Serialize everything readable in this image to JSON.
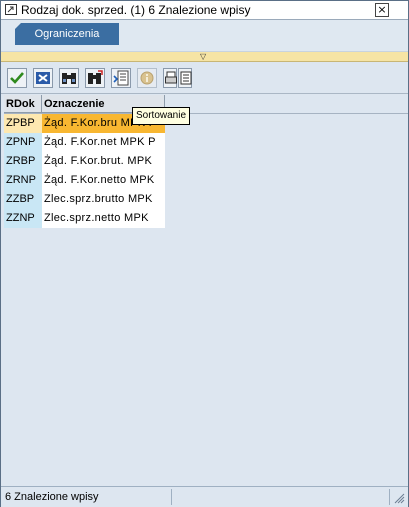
{
  "window": {
    "title": "Rodzaj dok. sprzed. (1)   6 Znalezione wpisy",
    "close_glyph": "×"
  },
  "tabs": [
    {
      "label": "Ograniczenia"
    }
  ],
  "collapse_glyph": "▽",
  "toolbar": {
    "buttons": [
      {
        "icon": "checkmark-icon"
      },
      {
        "icon": "cancel-x-icon"
      },
      {
        "icon": "binoculars-icon"
      },
      {
        "icon": "find-next-icon"
      },
      {
        "icon": "sort-icon"
      },
      {
        "icon": "info-icon"
      },
      {
        "icon": "print-icon"
      },
      {
        "icon": "list-icon"
      }
    ],
    "tooltip": "Sortowanie"
  },
  "grid": {
    "columns": [
      "RDok",
      "Oznaczenie"
    ],
    "rows": [
      {
        "code": "ZPBP",
        "desc": "Żąd. F.Kor.bru MPK P",
        "selected": true
      },
      {
        "code": "ZPNP",
        "desc": "Żąd. F.Kor.net MPK P",
        "selected": false
      },
      {
        "code": "ZRBP",
        "desc": "Żąd. F.Kor.brut. MPK",
        "selected": false
      },
      {
        "code": "ZRNP",
        "desc": "Żąd. F.Kor.netto MPK",
        "selected": false
      },
      {
        "code": "ZZBP",
        "desc": "Zlec.sprz.brutto MPK",
        "selected": false
      },
      {
        "code": "ZZNP",
        "desc": "Zlec.sprz.netto MPK",
        "selected": false
      }
    ]
  },
  "status": {
    "text": "6 Znalezione wpisy"
  },
  "colors": {
    "tab": "#3b6ea2",
    "selected_row": "#f8b731",
    "key_column": "#c9e7f5",
    "collapse_strip": "#f6e4a4"
  }
}
